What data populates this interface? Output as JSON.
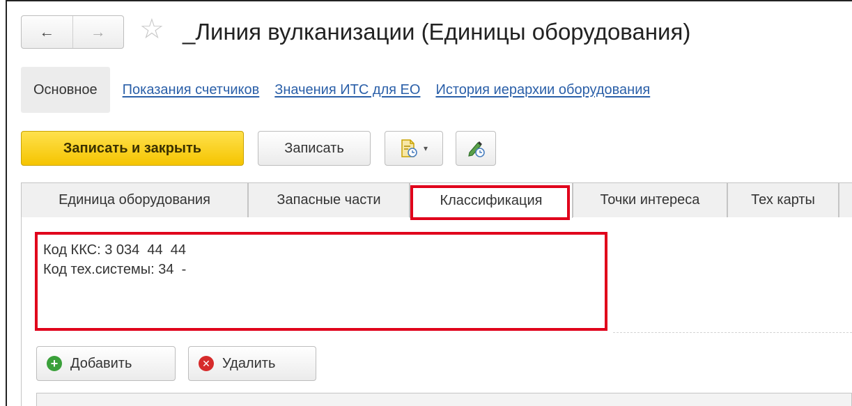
{
  "window": {
    "title": "_Линия вулканизации (Единицы оборудования)",
    "back_icon": "←",
    "forward_icon": "→",
    "favorite_icon": "☆"
  },
  "sections": {
    "active": "Основное",
    "links": [
      "Показания счетчиков",
      "Значения ИТС для ЕО",
      "История иерархии оборудования"
    ]
  },
  "toolbar": {
    "save_close_label": "Записать и закрыть",
    "save_label": "Записать",
    "dropdown_arrow": "▾"
  },
  "tabs": [
    "Единица оборудования",
    "Запасные части",
    "Классификация",
    "Точки интереса",
    "Тех карты"
  ],
  "classification": {
    "line1": "Код ККС: 3 034  44  44",
    "line2": "Код тех.системы: 34  -"
  },
  "actions": {
    "add_label": "Добавить",
    "delete_label": "Удалить",
    "add_icon": "+",
    "delete_icon": "✕"
  },
  "colors": {
    "accent": "#f5c400",
    "highlight": "#e0001b",
    "link": "#2a5fa8"
  }
}
